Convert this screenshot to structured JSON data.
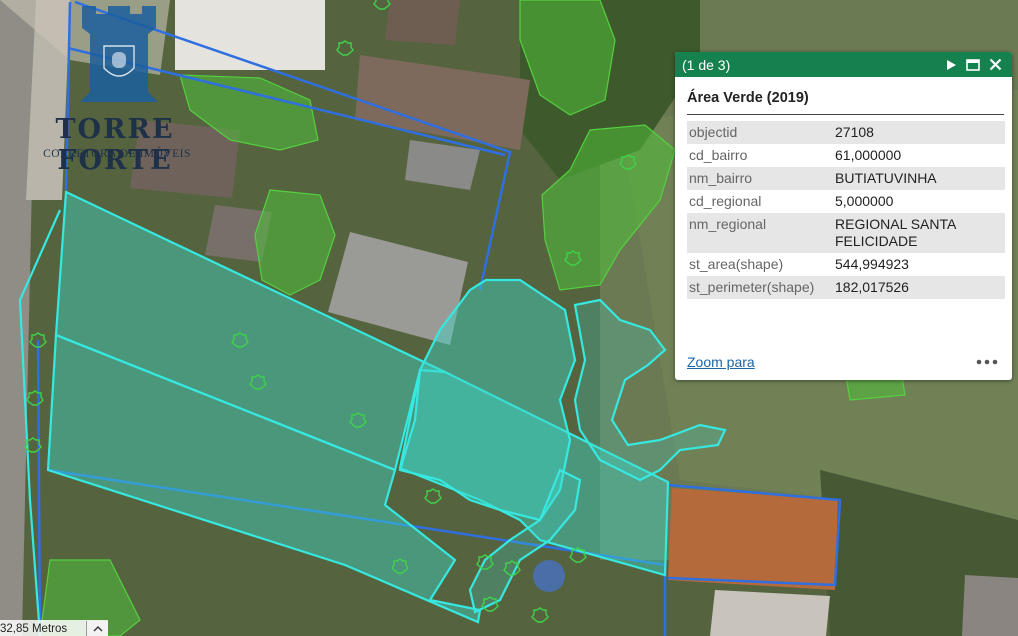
{
  "watermark": {
    "brand": "TORRE FORTE",
    "tagline": "CORRETORA DE IMÓVEIS"
  },
  "popup": {
    "counter": "(1 de 3)",
    "title": "Área Verde (2019)",
    "fields": [
      {
        "key": "objectid",
        "value": "27108"
      },
      {
        "key": "cd_bairro",
        "value": "61,000000"
      },
      {
        "key": "nm_bairro",
        "value": "BUTIATUVINHA"
      },
      {
        "key": "cd_regional",
        "value": "5,000000"
      },
      {
        "key": "nm_regional",
        "value": "REGIONAL SANTA FELICIDADE"
      },
      {
        "key": "st_area(shape)",
        "value": "544,994923"
      },
      {
        "key": "st_perimeter(shape)",
        "value": "182,017526"
      }
    ],
    "zoom_label": "Zoom para",
    "header_color": "#15814f"
  },
  "scalebar": {
    "label": "32,85 Metros"
  },
  "colors": {
    "parcel_outline": "#2f6fe0",
    "selection_outline": "#36e8e0",
    "green_area": "#3fbf3a"
  },
  "icons": [
    "next-feature-icon",
    "maximize-icon",
    "close-icon",
    "more-options-icon",
    "chevron-up-icon",
    "tree-symbol-icon"
  ]
}
